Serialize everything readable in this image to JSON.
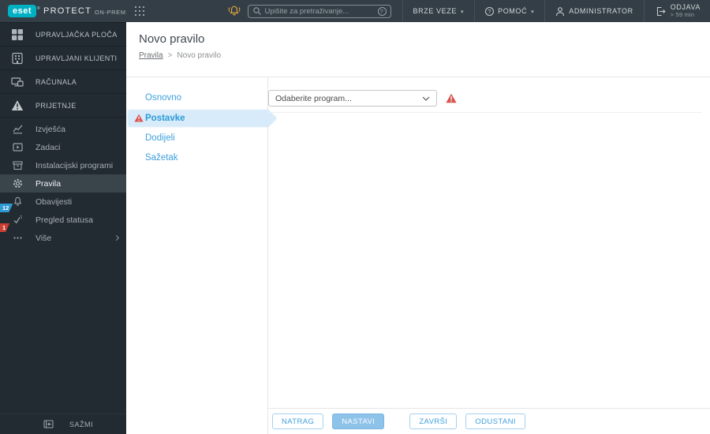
{
  "topbar": {
    "brand": {
      "logo_text": "eset",
      "logo_reg": "®",
      "product": "PROTECT",
      "edition": "ON-PREM"
    },
    "search": {
      "placeholder": "Upišite za pretraživanje..."
    },
    "quick_links_label": "BRZE VEZE",
    "help_label": "POMOĆ",
    "user_label": "ADMINISTRATOR",
    "logout_label": "ODJAVA",
    "session_timeout": "> 59 min"
  },
  "sidebar": {
    "main_items": [
      {
        "label": "UPRAVLJAČKA PLOČA",
        "icon": "dashboard-icon"
      },
      {
        "label": "UPRAVLJANI KLIJENTI",
        "icon": "clients-icon"
      },
      {
        "label": "RAČUNALA",
        "icon": "computers-icon"
      },
      {
        "label": "PRIJETNJE",
        "icon": "threats-icon"
      }
    ],
    "secondary_items": [
      {
        "label": "Izvješća",
        "icon": "reports-icon"
      },
      {
        "label": "Zadaci",
        "icon": "tasks-icon"
      },
      {
        "label": "Instalacijski programi",
        "icon": "installers-icon"
      },
      {
        "label": "Pravila",
        "icon": "policies-icon",
        "active": true
      },
      {
        "label": "Obavijesti",
        "icon": "notifications-icon"
      },
      {
        "label": "Pregled statusa",
        "icon": "status-icon",
        "badge": "12"
      },
      {
        "label": "Više",
        "icon": "more-icon",
        "badge": "1",
        "has_submenu": true
      }
    ],
    "badges": {
      "status_count": "12",
      "more_count": "1"
    },
    "collapse_label": "SAŽMI"
  },
  "page": {
    "title": "Novo pravilo",
    "breadcrumb_separator": ">",
    "breadcrumb": [
      {
        "label": "Pravila"
      },
      {
        "label": "Novo pravilo"
      }
    ]
  },
  "wizard": {
    "steps": [
      {
        "label": "Osnovno"
      },
      {
        "label": "Postavke",
        "active": true,
        "warning": true
      },
      {
        "label": "Dodijeli"
      },
      {
        "label": "Sažetak"
      }
    ],
    "form": {
      "program_select": {
        "value": "Odaberite program...",
        "warning": true
      }
    },
    "footer_buttons": [
      {
        "label": "NATRAG",
        "style": "secondary"
      },
      {
        "label": "NASTAVI",
        "style": "primary"
      },
      {
        "label": "ZAVRŠI",
        "style": "secondary"
      },
      {
        "label": "ODUSTANI",
        "style": "secondary"
      }
    ]
  },
  "colors": {
    "brand_teal": "#00b1c4",
    "topbar_bg": "#333e46",
    "sidebar_bg": "#222b31",
    "accent_blue": "#3da0dc",
    "active_step_bg": "#d7ebfa",
    "warning_red": "#d9534f",
    "badge_blue": "#2f99d3",
    "badge_red": "#cb3e33",
    "alert_bell_orange": "#e0a63e",
    "primary_button_bg": "#8dc2e9"
  }
}
